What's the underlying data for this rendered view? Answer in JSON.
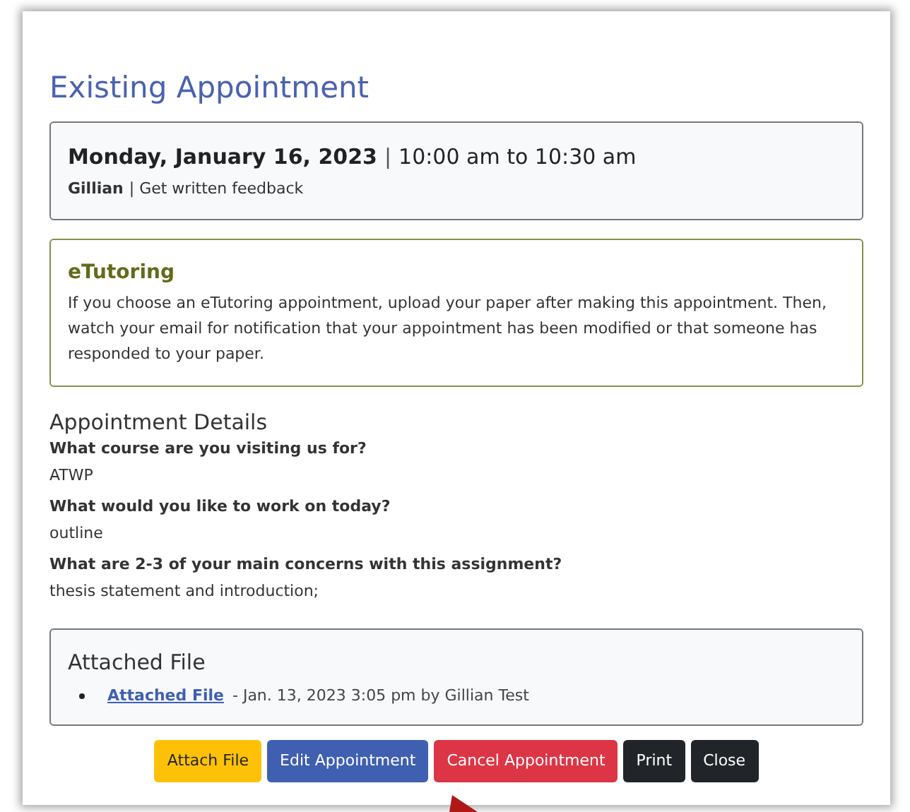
{
  "title": "Existing Appointment",
  "appointment": {
    "date": "Monday, January 16, 2023",
    "separator": "|",
    "time": "10:00 am to 10:30 am",
    "tutor": "Gillian",
    "service": "| Get written feedback"
  },
  "notice": {
    "title": "eTutoring",
    "text": "If you choose an eTutoring appointment, upload your paper after making this appointment. Then, watch your email for notification that your appointment has been modified or that someone has responded to your paper."
  },
  "details": {
    "heading": "Appointment Details",
    "items": [
      {
        "question": "What course are you visiting us for?",
        "answer": "ATWP"
      },
      {
        "question": "What would you like to work on today?",
        "answer": "outline"
      },
      {
        "question": "What are 2-3 of your main concerns with this assignment?",
        "answer": "thesis statement and introduction;"
      }
    ]
  },
  "attachments": {
    "heading": "Attached File",
    "files": [
      {
        "link": "Attached File",
        "info": "- Jan. 13, 2023 3:05 pm by Gillian Test"
      }
    ]
  },
  "buttons": [
    {
      "label": "Attach File",
      "kind": "warning"
    },
    {
      "label": "Edit Appointment",
      "kind": "primary"
    },
    {
      "label": "Cancel Appointment",
      "kind": "danger"
    },
    {
      "label": "Print",
      "kind": "dark"
    },
    {
      "label": "Close",
      "kind": "dark"
    }
  ]
}
